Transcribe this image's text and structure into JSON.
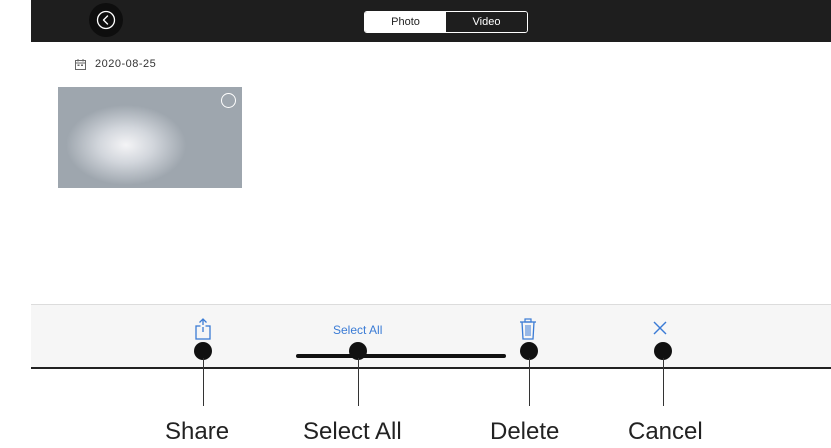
{
  "header": {
    "back_icon": "back-circle-icon",
    "tabs": [
      {
        "label": "Photo",
        "active": true
      },
      {
        "label": "Video",
        "active": false
      }
    ]
  },
  "gallery": {
    "date_icon": "calendar-icon",
    "date": "2020-08-25",
    "items": [
      {
        "type": "photo",
        "selected": false
      }
    ]
  },
  "toolbar": {
    "share_icon": "share-icon",
    "select_all_label": "Select All",
    "delete_icon": "trash-icon",
    "cancel_icon": "close-icon"
  },
  "callouts": {
    "share": "Share",
    "select_all": "Select All",
    "delete": "Delete",
    "cancel": "Cancel"
  },
  "colors": {
    "header_bg": "#1e1e1e",
    "accent": "#3a7bd5",
    "toolbar_bg": "#f6f6f6"
  }
}
